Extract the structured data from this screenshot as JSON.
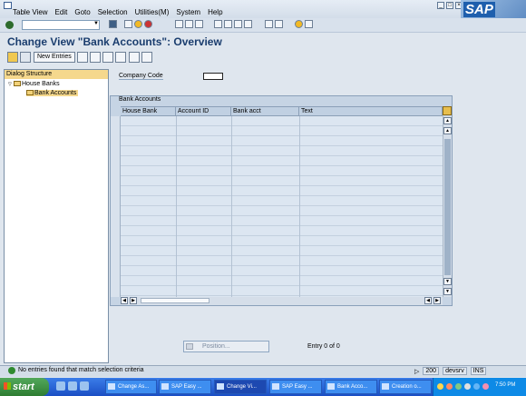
{
  "menu": [
    "Table View",
    "Edit",
    "Goto",
    "Selection",
    "Utilities(M)",
    "System",
    "Help"
  ],
  "window_buttons": [
    "_",
    "□",
    "×"
  ],
  "logo": "SAP",
  "title": "Change View \"Bank Accounts\": Overview",
  "toolbar": {
    "new_entries": "New Entries"
  },
  "dialog_structure": {
    "title": "Dialog Structure",
    "items": [
      "House Banks",
      "Bank Accounts"
    ]
  },
  "company_code": {
    "label": "Company Code",
    "value": ""
  },
  "table": {
    "caption": "Bank Accounts",
    "columns": [
      "House Bank",
      "Account ID",
      "Bank acct",
      "Text"
    ],
    "rows": []
  },
  "position_button": "Position...",
  "entry_text": "Entry 0 of 0",
  "status": {
    "message": "No entries found that match selection criteria",
    "client": "200",
    "server": "devsrv",
    "mode": "INS"
  },
  "taskbar": {
    "start": "start",
    "tasks": [
      "Change As...",
      "SAP Easy ...",
      "Change Vi...",
      "SAP Easy ...",
      "Bank Acco...",
      "Creation o..."
    ],
    "clock": "7:50 PM"
  }
}
